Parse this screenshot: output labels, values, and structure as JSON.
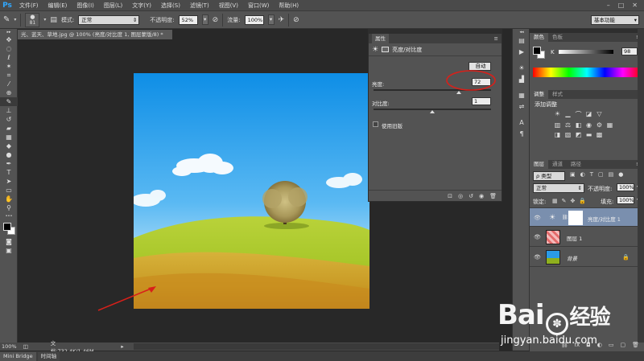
{
  "menubar": {
    "logo": "Ps",
    "items": [
      "文件(F)",
      "编辑(E)",
      "图像(I)",
      "图层(L)",
      "文字(Y)",
      "选择(S)",
      "滤镜(T)",
      "视图(V)",
      "窗口(W)",
      "帮助(H)"
    ],
    "controls": [
      "–",
      "□",
      "✕"
    ]
  },
  "options": {
    "brush_size": "81",
    "mode_label": "模式:",
    "mode_value": "正常",
    "opacity_label": "不透明度:",
    "opacity_value": "52%",
    "flow_label": "流量:",
    "flow_value": "100%",
    "workspace": "基本功能"
  },
  "document": {
    "tab_title": "光、蓝天、草地.jpg @ 100% (亮度/对比度 1, 图层蒙版/8) *",
    "tab_close": "×"
  },
  "status": {
    "zoom": "100%",
    "doc_info": "文档:732.4K/1.46M"
  },
  "bottom_tabs": [
    "Mini Bridge",
    "时间轴"
  ],
  "properties": {
    "title": "属性",
    "adjust_name": "亮度/对比度",
    "auto_button": "自动",
    "brightness_label": "亮度:",
    "brightness_value": "72",
    "contrast_label": "对比度:",
    "contrast_value": "1",
    "legacy_label": "使用旧版"
  },
  "right": {
    "color_tabs": [
      "颜色",
      "色板"
    ],
    "k_label": "K",
    "k_value": "98",
    "adjust_tabs": [
      "调整",
      "样式"
    ],
    "add_adjust_label": "添加调整",
    "layers_tabs": [
      "图层",
      "通道",
      "路径"
    ],
    "kind_filter": "ρ 类型",
    "blend_mode": "正常",
    "opacity_label": "不透明度:",
    "opacity_value": "100%",
    "lock_label": "锁定:",
    "fill_label": "填充:",
    "fill_value": "100%",
    "layers": [
      {
        "name": "亮度/对比度 1",
        "selected": true
      },
      {
        "name": "图层 1",
        "selected": false
      },
      {
        "name": "背景",
        "selected": false
      }
    ]
  },
  "watermark": {
    "brand": "Bai",
    "brand_mid": "经验",
    "url": "jingyan.baidu.com"
  },
  "colors": {
    "accent": "#31a8ff",
    "annotation_red": "#d8201a",
    "selected_layer": "#7a8fae"
  }
}
